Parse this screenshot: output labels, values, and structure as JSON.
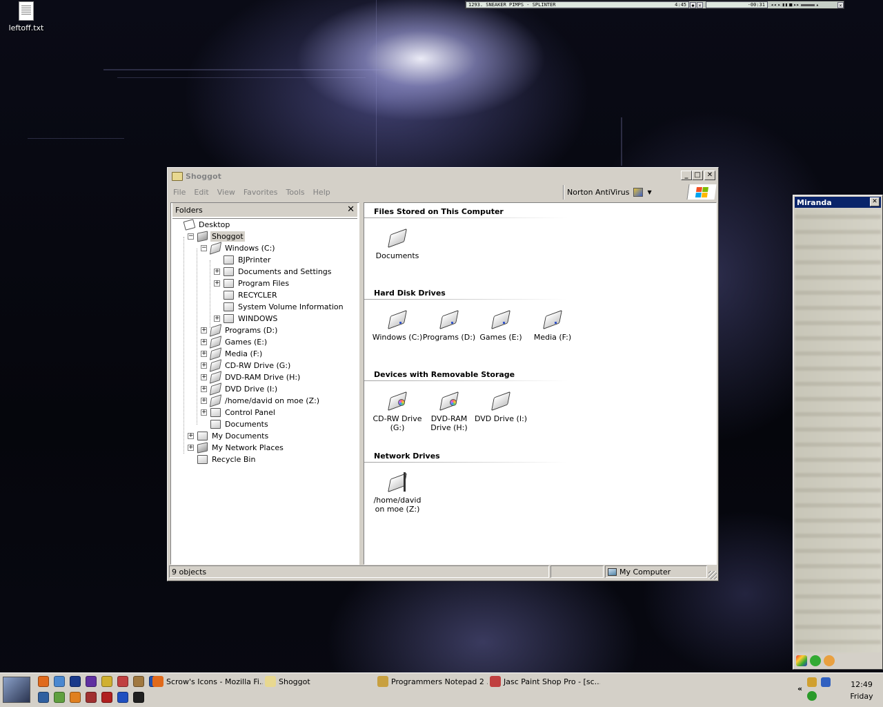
{
  "desktop": {
    "icon_label": "leftoff.txt"
  },
  "winamp": {
    "track": "1293. SNEAKER PIMPS - SPLINTER",
    "time": "4:45",
    "remaining": "-00:31"
  },
  "window": {
    "title": "Shoggot",
    "menu": [
      "File",
      "Edit",
      "View",
      "Favorites",
      "Tools",
      "Help"
    ],
    "toolbar_label": "Norton AntiVirus",
    "folders_header": "Folders",
    "tree": [
      {
        "label": "Desktop",
        "expander": ""
      },
      {
        "label": "Shoggot",
        "expander": "−"
      },
      {
        "label": "Windows (C:)",
        "expander": "−"
      },
      {
        "label": "BJPrinter",
        "expander": ""
      },
      {
        "label": "Documents and Settings",
        "expander": "+"
      },
      {
        "label": "Program Files",
        "expander": "+"
      },
      {
        "label": "RECYCLER",
        "expander": ""
      },
      {
        "label": "System Volume Information",
        "expander": ""
      },
      {
        "label": "WINDOWS",
        "expander": "+"
      },
      {
        "label": "Programs (D:)",
        "expander": "+"
      },
      {
        "label": "Games (E:)",
        "expander": "+"
      },
      {
        "label": "Media (F:)",
        "expander": "+"
      },
      {
        "label": "CD-RW Drive (G:)",
        "expander": "+"
      },
      {
        "label": "DVD-RAM Drive (H:)",
        "expander": "+"
      },
      {
        "label": "DVD Drive (I:)",
        "expander": "+"
      },
      {
        "label": "/home/david on moe (Z:)",
        "expander": "+"
      },
      {
        "label": "Control Panel",
        "expander": "+"
      },
      {
        "label": "Documents",
        "expander": ""
      },
      {
        "label": "My Documents",
        "expander": "+"
      },
      {
        "label": "My Network Places",
        "expander": "+"
      },
      {
        "label": "Recycle Bin",
        "expander": ""
      }
    ],
    "groups": [
      {
        "title": "Files Stored on This Computer",
        "items": [
          {
            "line1": "Documents",
            "line2": "",
            "kind": "folder"
          }
        ]
      },
      {
        "title": "Hard Disk Drives",
        "items": [
          {
            "line1": "Windows (C:)",
            "line2": "",
            "kind": "hdd"
          },
          {
            "line1": "Programs (D:)",
            "line2": "",
            "kind": "hdd"
          },
          {
            "line1": "Games (E:)",
            "line2": "",
            "kind": "hdd"
          },
          {
            "line1": "Media (F:)",
            "line2": "",
            "kind": "hdd"
          }
        ]
      },
      {
        "title": "Devices with Removable Storage",
        "items": [
          {
            "line1": "CD-RW Drive",
            "line2": "(G:)",
            "kind": "cd"
          },
          {
            "line1": "DVD-RAM",
            "line2": "Drive (H:)",
            "kind": "cd"
          },
          {
            "line1": "DVD Drive (I:)",
            "line2": "",
            "kind": "dvd"
          }
        ]
      },
      {
        "title": "Network Drives",
        "items": [
          {
            "line1": "/home/david",
            "line2": "on moe (Z:)",
            "kind": "net"
          }
        ]
      }
    ],
    "status": {
      "objects": "9 objects",
      "zone": "My Computer"
    }
  },
  "miranda": {
    "title": "Miranda"
  },
  "taskbar": {
    "tasks": [
      {
        "label": "Scrow's Icons - Mozilla Fi...",
        "icon": "firefox-icon",
        "color": "#e06a1c"
      },
      {
        "label": "Shoggot",
        "icon": "folder-icon",
        "color": "#e8d890"
      },
      {
        "label": "Programmers Notepad 2 ...",
        "icon": "notepad-icon",
        "color": "#c8a040"
      },
      {
        "label": "Jasc Paint Shop Pro - [sc...",
        "icon": "paint-icon",
        "color": "#c04040"
      }
    ],
    "clock": {
      "time": "12:49",
      "day": "Friday"
    }
  }
}
